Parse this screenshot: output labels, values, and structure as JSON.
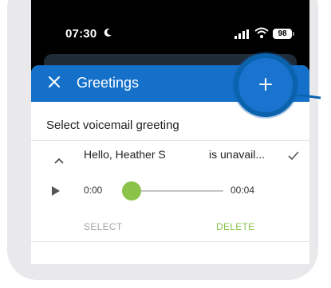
{
  "status_bar": {
    "time": "07:30",
    "battery": "98",
    "icons": [
      "moon-icon",
      "signal-icon",
      "wifi-icon",
      "battery-icon"
    ]
  },
  "dialog": {
    "title": "Greetings",
    "subheader": "Select voicemail greeting",
    "greeting": {
      "name": "Hello, Heather S",
      "suffix": "is unavail...",
      "selected": true,
      "time_start": "0:00",
      "time_end": "00:04",
      "progress": 0.0,
      "select_label": "SELECT",
      "delete_label": "DELETE"
    }
  },
  "colors": {
    "appbar": "#1470c9",
    "accent_green": "#8bc34a",
    "highlight": "#0b62ad"
  }
}
